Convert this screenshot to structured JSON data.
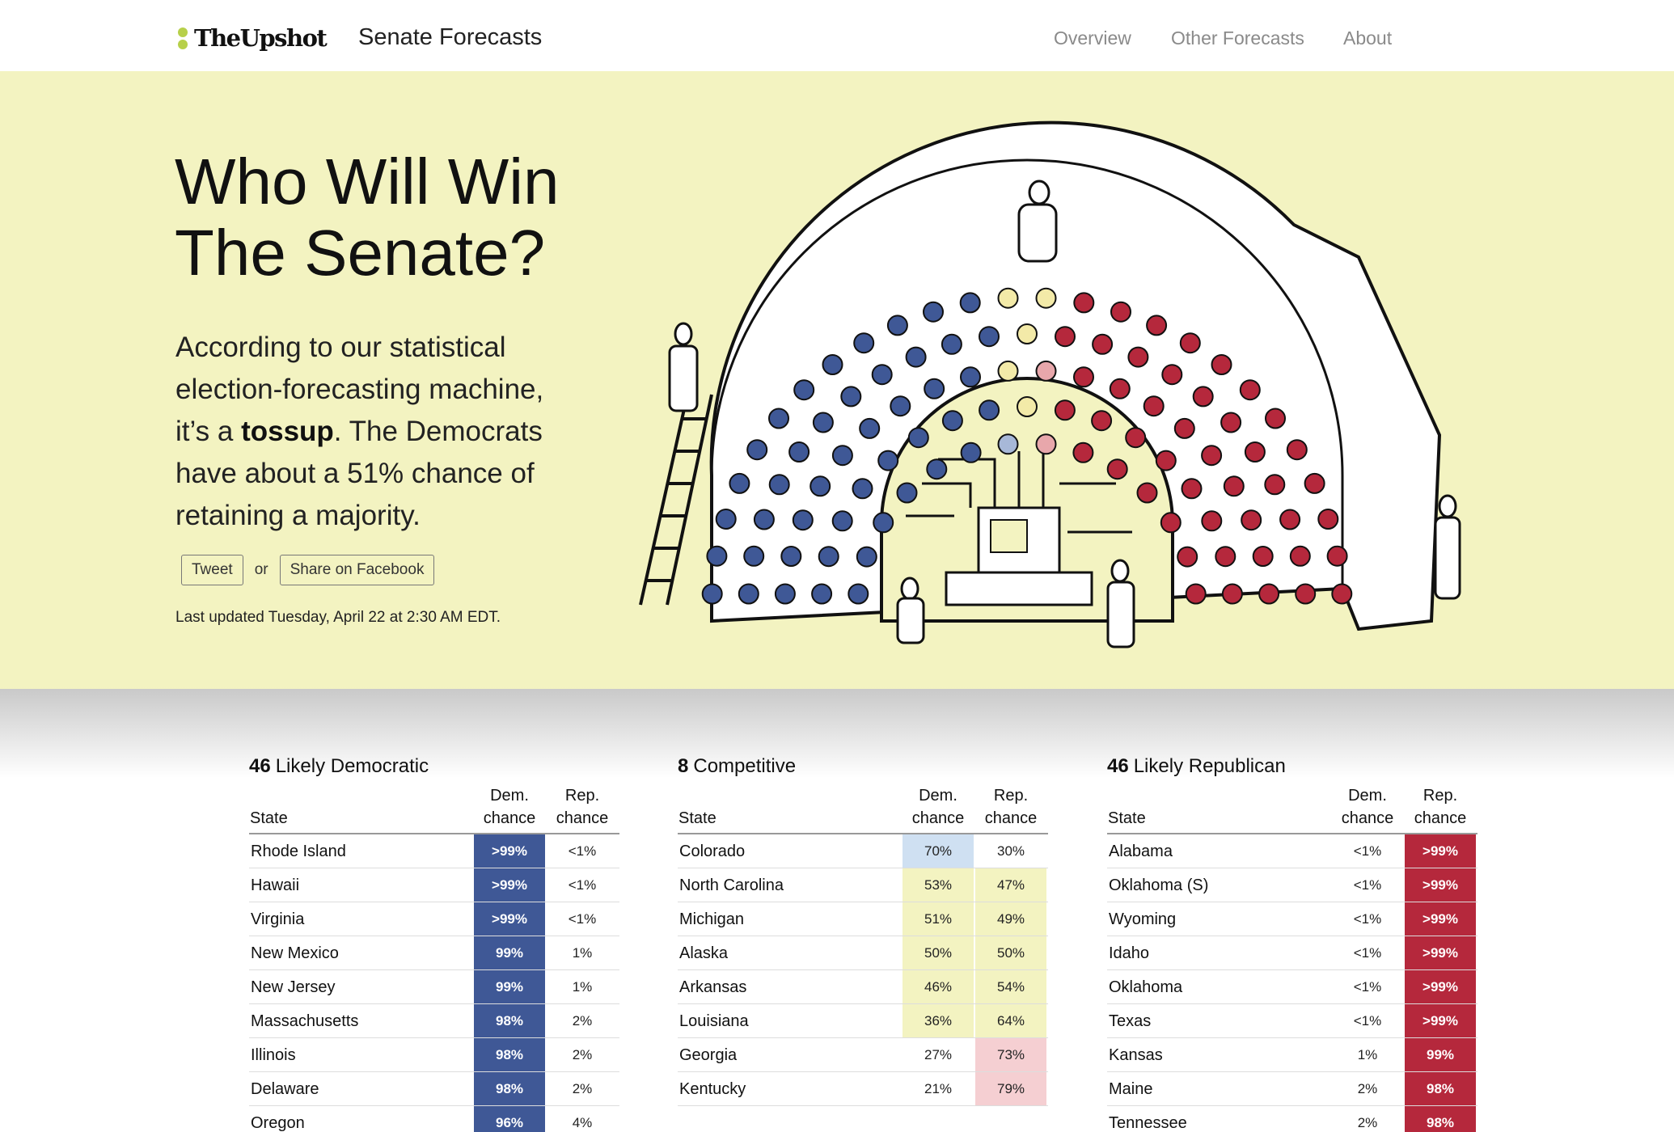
{
  "header": {
    "logo": "TheUpshot",
    "section": "Senate Forecasts",
    "nav": [
      "Overview",
      "Other Forecasts",
      "About"
    ]
  },
  "hero": {
    "headline": "Who Will Win\nThe  Senate?",
    "deck_before": "According to our statistical election-forecasting machine, it’s a ",
    "deck_bold": "tossup",
    "deck_after": ". The Democrats have about a 51% chance of retaining a majority.",
    "tweet": "Tweet",
    "or": "or",
    "facebook": "Share on Facebook",
    "updated": "Last updated Tuesday, April 22 at 2:30 AM EDT.",
    "seat_colors": {
      "dem": "#3f5896",
      "lean_dem": "#a7b8d8",
      "tossup": "#f3eaa8",
      "lean_rep": "#e8a7ab",
      "rep": "#b5283c"
    }
  },
  "tables": {
    "headers": {
      "state": "State",
      "dem": "Dem.\nchance",
      "rep": "Rep.\nchance"
    },
    "columns": [
      {
        "count": "46",
        "label": "Likely Democratic",
        "rows": [
          {
            "state": "Rhode Island",
            "dem": ">99%",
            "rep": "<1%",
            "shade": "dem"
          },
          {
            "state": "Hawaii",
            "dem": ">99%",
            "rep": "<1%",
            "shade": "dem"
          },
          {
            "state": "Virginia",
            "dem": ">99%",
            "rep": "<1%",
            "shade": "dem"
          },
          {
            "state": "New Mexico",
            "dem": "99%",
            "rep": "1%",
            "shade": "dem"
          },
          {
            "state": "New Jersey",
            "dem": "99%",
            "rep": "1%",
            "shade": "dem"
          },
          {
            "state": "Massachusetts",
            "dem": "98%",
            "rep": "2%",
            "shade": "dem"
          },
          {
            "state": "Illinois",
            "dem": "98%",
            "rep": "2%",
            "shade": "dem"
          },
          {
            "state": "Delaware",
            "dem": "98%",
            "rep": "2%",
            "shade": "dem"
          },
          {
            "state": "Oregon",
            "dem": "96%",
            "rep": "4%",
            "shade": "dem"
          }
        ]
      },
      {
        "count": "8",
        "label": "Competitive",
        "rows": [
          {
            "state": "Colorado",
            "dem": "70%",
            "rep": "30%",
            "shade": "lean-d"
          },
          {
            "state": "North Carolina",
            "dem": "53%",
            "rep": "47%",
            "shade": "toss"
          },
          {
            "state": "Michigan",
            "dem": "51%",
            "rep": "49%",
            "shade": "toss"
          },
          {
            "state": "Alaska",
            "dem": "50%",
            "rep": "50%",
            "shade": "toss"
          },
          {
            "state": "Arkansas",
            "dem": "46%",
            "rep": "54%",
            "shade": "toss"
          },
          {
            "state": "Louisiana",
            "dem": "36%",
            "rep": "64%",
            "shade": "toss"
          },
          {
            "state": "Georgia",
            "dem": "27%",
            "rep": "73%",
            "shade": "lean-r"
          },
          {
            "state": "Kentucky",
            "dem": "21%",
            "rep": "79%",
            "shade": "lean-r"
          }
        ]
      },
      {
        "count": "46",
        "label": "Likely Republican",
        "rows": [
          {
            "state": "Alabama",
            "dem": "<1%",
            "rep": ">99%",
            "shade": "rep"
          },
          {
            "state": "Oklahoma (S)",
            "dem": "<1%",
            "rep": ">99%",
            "shade": "rep"
          },
          {
            "state": "Wyoming",
            "dem": "<1%",
            "rep": ">99%",
            "shade": "rep"
          },
          {
            "state": "Idaho",
            "dem": "<1%",
            "rep": ">99%",
            "shade": "rep"
          },
          {
            "state": "Oklahoma",
            "dem": "<1%",
            "rep": ">99%",
            "shade": "rep"
          },
          {
            "state": "Texas",
            "dem": "<1%",
            "rep": ">99%",
            "shade": "rep"
          },
          {
            "state": "Kansas",
            "dem": "1%",
            "rep": "99%",
            "shade": "rep"
          },
          {
            "state": "Maine",
            "dem": "2%",
            "rep": "98%",
            "shade": "rep"
          },
          {
            "state": "Tennessee",
            "dem": "2%",
            "rep": "98%",
            "shade": "rep"
          }
        ]
      }
    ]
  }
}
